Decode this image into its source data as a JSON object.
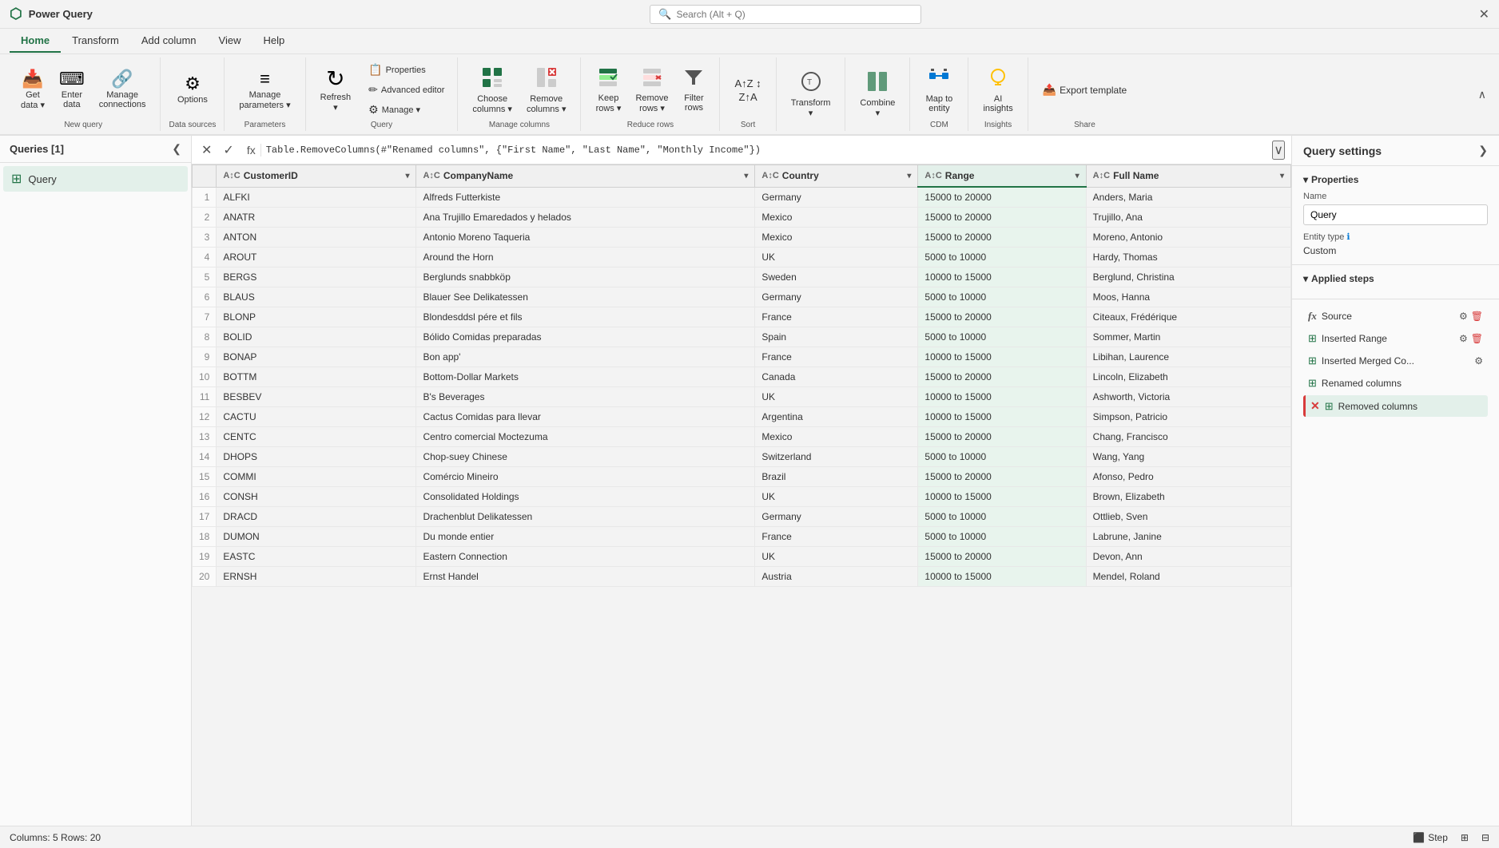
{
  "app": {
    "title": "Power Query",
    "close_label": "✕"
  },
  "search": {
    "placeholder": "Search (Alt + Q)"
  },
  "ribbon": {
    "tabs": [
      "Home",
      "Transform",
      "Add column",
      "View",
      "Help"
    ],
    "active_tab": "Home",
    "groups": [
      {
        "label": "New query",
        "items": [
          {
            "id": "get-data",
            "icon": "📥",
            "label": "Get\ndata ▾"
          },
          {
            "id": "enter-data",
            "icon": "⌨",
            "label": "Enter\ndata"
          },
          {
            "id": "manage-connections",
            "icon": "🔗",
            "label": "Manage\nconnections"
          }
        ]
      },
      {
        "label": "Data sources",
        "items": [
          {
            "id": "options",
            "icon": "⚙",
            "label": "Options"
          }
        ]
      },
      {
        "label": "Parameters",
        "items": [
          {
            "id": "manage-parameters",
            "icon": "≡",
            "label": "Manage\nparameters ▾"
          }
        ]
      },
      {
        "label": "Query",
        "items": [
          {
            "id": "refresh",
            "icon": "↻",
            "label": "Refresh\n▾"
          },
          {
            "id": "properties",
            "label": "Properties",
            "small": true,
            "icon": "📋"
          },
          {
            "id": "advanced-editor",
            "label": "Advanced editor",
            "small": true,
            "icon": "✏"
          },
          {
            "id": "manage",
            "label": "Manage ▾",
            "small": true,
            "icon": "⚙"
          }
        ]
      },
      {
        "label": "Manage columns",
        "items": [
          {
            "id": "choose-columns",
            "icon": "⊞",
            "label": "Choose\ncolumns ▾"
          },
          {
            "id": "remove-columns",
            "icon": "⊟",
            "label": "Remove\ncolumns ▾"
          }
        ]
      },
      {
        "label": "Reduce rows",
        "items": [
          {
            "id": "keep-rows",
            "icon": "🔒",
            "label": "Keep\nrows ▾"
          },
          {
            "id": "remove-rows",
            "icon": "✖",
            "label": "Remove\nrows ▾"
          },
          {
            "id": "filter-rows",
            "icon": "▽",
            "label": "Filter\nrows"
          }
        ]
      },
      {
        "label": "Sort",
        "items": [
          {
            "id": "sort-az",
            "icon": "↕",
            "label": "A↑Z\nZ↑A"
          }
        ]
      },
      {
        "label": "",
        "items": [
          {
            "id": "transform",
            "icon": "💡",
            "label": "Transform\n▾"
          }
        ]
      },
      {
        "label": "",
        "items": [
          {
            "id": "combine",
            "icon": "⊞",
            "label": "Combine\n▾"
          }
        ]
      },
      {
        "label": "CDM",
        "items": [
          {
            "id": "map-to-entity",
            "icon": "🗺",
            "label": "Map to\nentity"
          }
        ]
      },
      {
        "label": "Insights",
        "items": [
          {
            "id": "ai-insights",
            "icon": "💡",
            "label": "AI\ninsights"
          }
        ]
      },
      {
        "label": "Share",
        "items": [
          {
            "id": "export-template",
            "icon": "📤",
            "label": "Export template"
          }
        ]
      }
    ]
  },
  "queries_panel": {
    "title": "Queries [1]",
    "items": [
      {
        "id": "query1",
        "label": "Query",
        "selected": true
      }
    ]
  },
  "formula_bar": {
    "formula": "Table.RemoveColumns(#\"Renamed columns\", {\"First Name\", \"Last Name\", \"Monthly Income\"})"
  },
  "table": {
    "columns": [
      {
        "id": "customerid",
        "type": "ABC",
        "label": "CustomerID",
        "selected": false
      },
      {
        "id": "companyname",
        "type": "ABC",
        "label": "CompanyName",
        "selected": false
      },
      {
        "id": "country",
        "type": "ABC",
        "label": "Country",
        "selected": false
      },
      {
        "id": "range",
        "type": "ABC",
        "label": "Range",
        "selected": true
      },
      {
        "id": "fullname",
        "type": "ABC",
        "label": "Full Name",
        "selected": false
      }
    ],
    "rows": [
      {
        "num": 1,
        "customerid": "ALFKI",
        "companyname": "Alfreds Futterkiste",
        "country": "Germany",
        "range": "15000 to 20000",
        "fullname": "Anders, Maria"
      },
      {
        "num": 2,
        "customerid": "ANATR",
        "companyname": "Ana Trujillo Emaredados y helados",
        "country": "Mexico",
        "range": "15000 to 20000",
        "fullname": "Trujillo, Ana"
      },
      {
        "num": 3,
        "customerid": "ANTON",
        "companyname": "Antonio Moreno Taqueria",
        "country": "Mexico",
        "range": "15000 to 20000",
        "fullname": "Moreno, Antonio"
      },
      {
        "num": 4,
        "customerid": "AROUT",
        "companyname": "Around the Horn",
        "country": "UK",
        "range": "5000 to 10000",
        "fullname": "Hardy, Thomas"
      },
      {
        "num": 5,
        "customerid": "BERGS",
        "companyname": "Berglunds snabbköp",
        "country": "Sweden",
        "range": "10000 to 15000",
        "fullname": "Berglund, Christina"
      },
      {
        "num": 6,
        "customerid": "BLAUS",
        "companyname": "Blauer See Delikatessen",
        "country": "Germany",
        "range": "5000 to 10000",
        "fullname": "Moos, Hanna"
      },
      {
        "num": 7,
        "customerid": "BLONP",
        "companyname": "Blondesddsl pére et fils",
        "country": "France",
        "range": "15000 to 20000",
        "fullname": "Citeaux, Frédérique"
      },
      {
        "num": 8,
        "customerid": "BOLID",
        "companyname": "Bólido Comidas preparadas",
        "country": "Spain",
        "range": "5000 to 10000",
        "fullname": "Sommer, Martin"
      },
      {
        "num": 9,
        "customerid": "BONAP",
        "companyname": "Bon app'",
        "country": "France",
        "range": "10000 to 15000",
        "fullname": "Libihan, Laurence"
      },
      {
        "num": 10,
        "customerid": "BOTTM",
        "companyname": "Bottom-Dollar Markets",
        "country": "Canada",
        "range": "15000 to 20000",
        "fullname": "Lincoln, Elizabeth"
      },
      {
        "num": 11,
        "customerid": "BESBEV",
        "companyname": "B's Beverages",
        "country": "UK",
        "range": "10000 to 15000",
        "fullname": "Ashworth, Victoria"
      },
      {
        "num": 12,
        "customerid": "CACTU",
        "companyname": "Cactus Comidas para llevar",
        "country": "Argentina",
        "range": "10000 to 15000",
        "fullname": "Simpson, Patricio"
      },
      {
        "num": 13,
        "customerid": "CENTC",
        "companyname": "Centro comercial Moctezuma",
        "country": "Mexico",
        "range": "15000 to 20000",
        "fullname": "Chang, Francisco"
      },
      {
        "num": 14,
        "customerid": "DHOPS",
        "companyname": "Chop-suey Chinese",
        "country": "Switzerland",
        "range": "5000 to 10000",
        "fullname": "Wang, Yang"
      },
      {
        "num": 15,
        "customerid": "COMMI",
        "companyname": "Comércio Mineiro",
        "country": "Brazil",
        "range": "15000 to 20000",
        "fullname": "Afonso, Pedro"
      },
      {
        "num": 16,
        "customerid": "CONSH",
        "companyname": "Consolidated Holdings",
        "country": "UK",
        "range": "10000 to 15000",
        "fullname": "Brown, Elizabeth"
      },
      {
        "num": 17,
        "customerid": "DRACD",
        "companyname": "Drachenblut Delikatessen",
        "country": "Germany",
        "range": "5000 to 10000",
        "fullname": "Ottlieb, Sven"
      },
      {
        "num": 18,
        "customerid": "DUMON",
        "companyname": "Du monde entier",
        "country": "France",
        "range": "5000 to 10000",
        "fullname": "Labrune, Janine"
      },
      {
        "num": 19,
        "customerid": "EASTC",
        "companyname": "Eastern Connection",
        "country": "UK",
        "range": "15000 to 20000",
        "fullname": "Devon, Ann"
      },
      {
        "num": 20,
        "customerid": "ERNSH",
        "companyname": "Ernst Handel",
        "country": "Austria",
        "range": "10000 to 15000",
        "fullname": "Mendel, Roland"
      }
    ]
  },
  "query_settings": {
    "title": "Query settings",
    "properties_label": "Properties",
    "name_label": "Name",
    "name_value": "Query",
    "entity_type_label": "Entity type",
    "entity_type_info": "ℹ",
    "entity_type_value": "Custom",
    "applied_steps_label": "Applied steps",
    "steps": [
      {
        "id": "source",
        "icon": "fx",
        "label": "Source",
        "has_gear": true,
        "has_delete": true,
        "selected": false,
        "error": false
      },
      {
        "id": "inserted-range",
        "icon": "table",
        "label": "Inserted Range",
        "has_gear": true,
        "has_delete": true,
        "selected": false,
        "error": false
      },
      {
        "id": "inserted-merged-co",
        "icon": "table",
        "label": "Inserted Merged Co...",
        "has_gear": true,
        "has_delete": false,
        "selected": false,
        "error": false
      },
      {
        "id": "renamed-columns",
        "icon": "table",
        "label": "Renamed columns",
        "has_gear": false,
        "has_delete": false,
        "selected": false,
        "error": false
      },
      {
        "id": "removed-columns",
        "icon": "table",
        "label": "Removed columns",
        "has_gear": false,
        "has_delete": false,
        "selected": true,
        "error": true
      }
    ]
  },
  "status_bar": {
    "left": "Columns: 5   Rows: 20",
    "step_btn": "Step",
    "diagram_btn": "⊞",
    "grid_btn": "⊟"
  }
}
